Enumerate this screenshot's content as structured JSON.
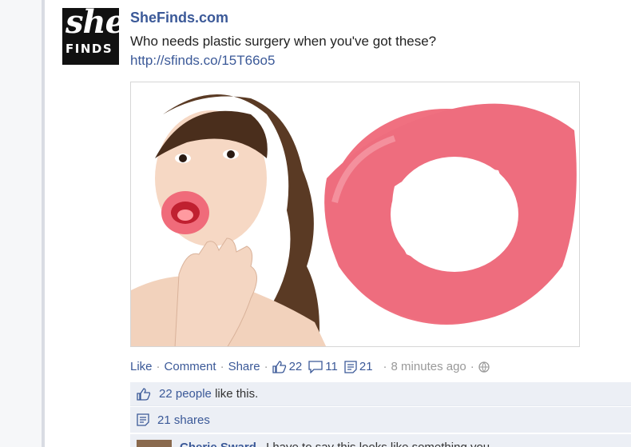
{
  "post": {
    "avatar_top": "she",
    "avatar_bottom": "FINDS",
    "author": "SheFinds.com",
    "message": "Who needs plastic surgery when you've got these?",
    "link": "http://sfinds.co/15T66o5"
  },
  "actions": {
    "like": "Like",
    "comment": "Comment",
    "share": "Share",
    "likes_count": "22",
    "comments_count": "11",
    "shares_count": "21",
    "timestamp": "8 minutes ago"
  },
  "ufi": {
    "likes_summary_link": "22 people",
    "likes_summary_text": " like this.",
    "shares_summary": "21 shares",
    "comment_author": "Cherie Sward",
    "comment_text": "I have to say this looks like something you"
  },
  "colors": {
    "link": "#3b5998",
    "ufi_bg": "#eceff5",
    "lip_pink": "#f07080"
  }
}
